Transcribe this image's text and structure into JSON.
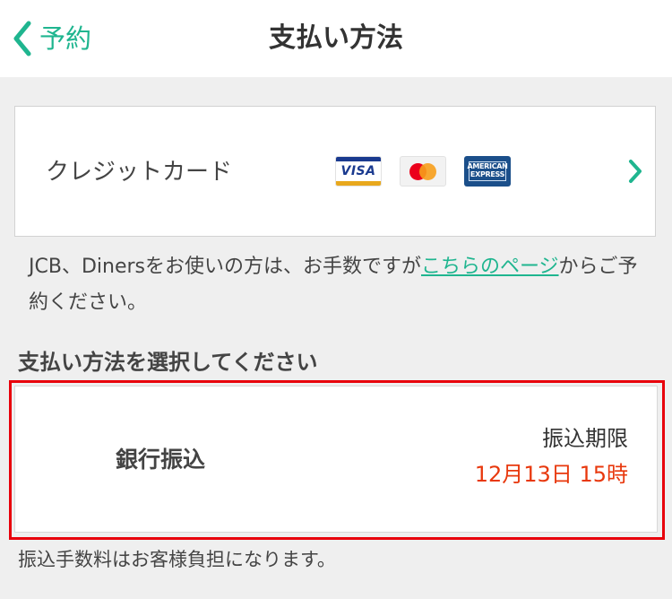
{
  "nav": {
    "back_label": "予約",
    "title": "支払い方法"
  },
  "credit_card": {
    "label": "クレジットカード",
    "brands": [
      "VISA",
      "Mastercard",
      "AMERICAN EXPRESS"
    ]
  },
  "note": {
    "prefix": "JCB、Dinersをお使いの方は、お手数ですが",
    "link": "こちらのページ",
    "suffix": "からご予約ください。"
  },
  "section_heading": "支払い方法を選択してください",
  "bank_transfer": {
    "label": "銀行振込",
    "deadline_label": "振込期限",
    "deadline_value": "12月13日 15時"
  },
  "fee_note": "振込手数料はお客様負担になります。",
  "colors": {
    "accent": "#1fb58f",
    "deadline": "#e8380d",
    "highlight": "#e8000b"
  }
}
